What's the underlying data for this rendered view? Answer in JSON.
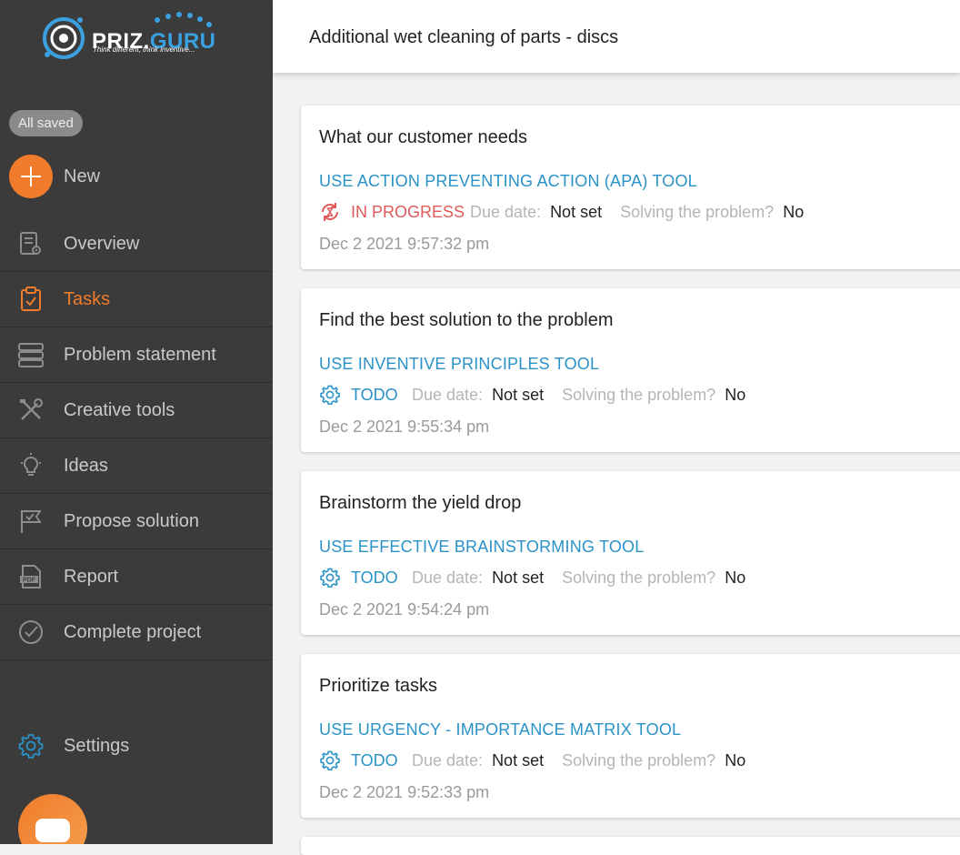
{
  "brand": {
    "name_part1": "PRIZ.",
    "name_part2": "GURU",
    "tagline": "Think different, think inventive..."
  },
  "sidebar": {
    "saved_status": "All saved",
    "new_label": "New",
    "items": [
      {
        "label": "Overview",
        "icon": "overview-icon"
      },
      {
        "label": "Tasks",
        "icon": "clipboard-check-icon",
        "active": true
      },
      {
        "label": "Problem statement",
        "icon": "stack-icon"
      },
      {
        "label": "Creative tools",
        "icon": "tools-icon"
      },
      {
        "label": "Ideas",
        "icon": "lightbulb-icon"
      },
      {
        "label": "Propose solution",
        "icon": "flag-icon"
      },
      {
        "label": "Report",
        "icon": "pdf-icon"
      },
      {
        "label": "Complete project",
        "icon": "check-circle-icon"
      }
    ],
    "settings_label": "Settings"
  },
  "header": {
    "title": "Additional wet cleaning of parts - discs"
  },
  "tasks": [
    {
      "title": "What our customer needs",
      "tool": "USE ACTION PREVENTING ACTION (APA) TOOL",
      "status": "IN PROGRESS",
      "due_label": "Due date:",
      "due_value": "Not set",
      "solving_label": "Solving the problem?",
      "solving_value": "No",
      "date": "Dec 2 2021 9:57:32 pm"
    },
    {
      "title": "Find the best solution to the problem",
      "tool": "USE INVENTIVE PRINCIPLES TOOL",
      "status": "TODO",
      "due_label": "Due date:",
      "due_value": "Not set",
      "solving_label": "Solving the problem?",
      "solving_value": "No",
      "date": "Dec 2 2021 9:55:34 pm"
    },
    {
      "title": "Brainstorm the yield drop",
      "tool": "USE EFFECTIVE BRAINSTORMING TOOL",
      "status": "TODO",
      "due_label": "Due date:",
      "due_value": "Not set",
      "solving_label": "Solving the problem?",
      "solving_value": "No",
      "date": "Dec 2 2021 9:54:24 pm"
    },
    {
      "title": "Prioritize tasks",
      "tool": "USE URGENCY - IMPORTANCE MATRIX TOOL",
      "status": "TODO",
      "due_label": "Due date:",
      "due_value": "Not set",
      "solving_label": "Solving the problem?",
      "solving_value": "No",
      "date": "Dec 2 2021 9:52:33 pm"
    }
  ],
  "colors": {
    "sidebar_bg": "#3b3b3b",
    "accent_orange": "#f07b2a",
    "link_blue": "#2a92c7",
    "progress_red": "#e05a5a"
  }
}
